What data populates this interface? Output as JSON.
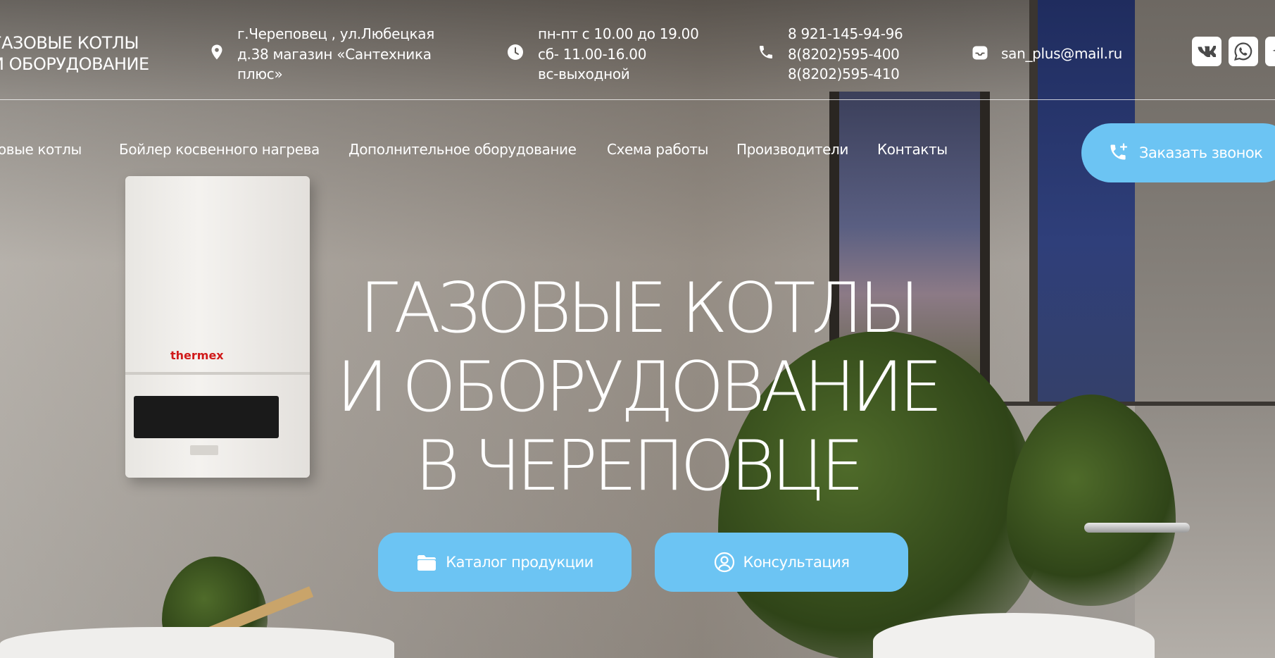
{
  "header": {
    "logo_line1": "ГАЗОВЫЕ КОТЛЫ",
    "logo_line2": "И ОБОРУДОВАНИЕ",
    "address": [
      "г.Череповец , ул.Любецкая",
      "д.38 магазин «Сантехника",
      "плюс»"
    ],
    "hours": [
      "пн-пт с 10.00 до 19.00",
      "сб- 11.00-16.00",
      "вс-выходной"
    ],
    "phones": [
      "8 921-145-94-96",
      "8(8202)595-400",
      "8(8202)595-410"
    ],
    "email": "san_plus@mail.ru",
    "icons": {
      "address": "location-pin-icon",
      "hours": "clock-icon",
      "phone": "phone-icon",
      "email": "mail-icon",
      "social": [
        "vk-icon",
        "whatsapp-icon",
        "telegram-icon"
      ]
    }
  },
  "nav": {
    "items": [
      "Газовые котлы",
      "Бойлер косвенного нагрева",
      "Дополнительное оборудование",
      "Схема работы",
      "Производители",
      "Контакты"
    ],
    "callback_label": "Заказать звонок"
  },
  "hero": {
    "title_lines": [
      "ГАЗОВЫЕ КОТЛЫ",
      "И ОБОРУДОВАНИЕ",
      "В ЧЕРЕПОВЦЕ"
    ],
    "catalog_label": "Каталог продукции",
    "consult_label": "Консультация"
  },
  "background": {
    "boiler_brand": "thermex"
  },
  "colors": {
    "accent": "#6cc4f3",
    "text": "#ffffff"
  }
}
